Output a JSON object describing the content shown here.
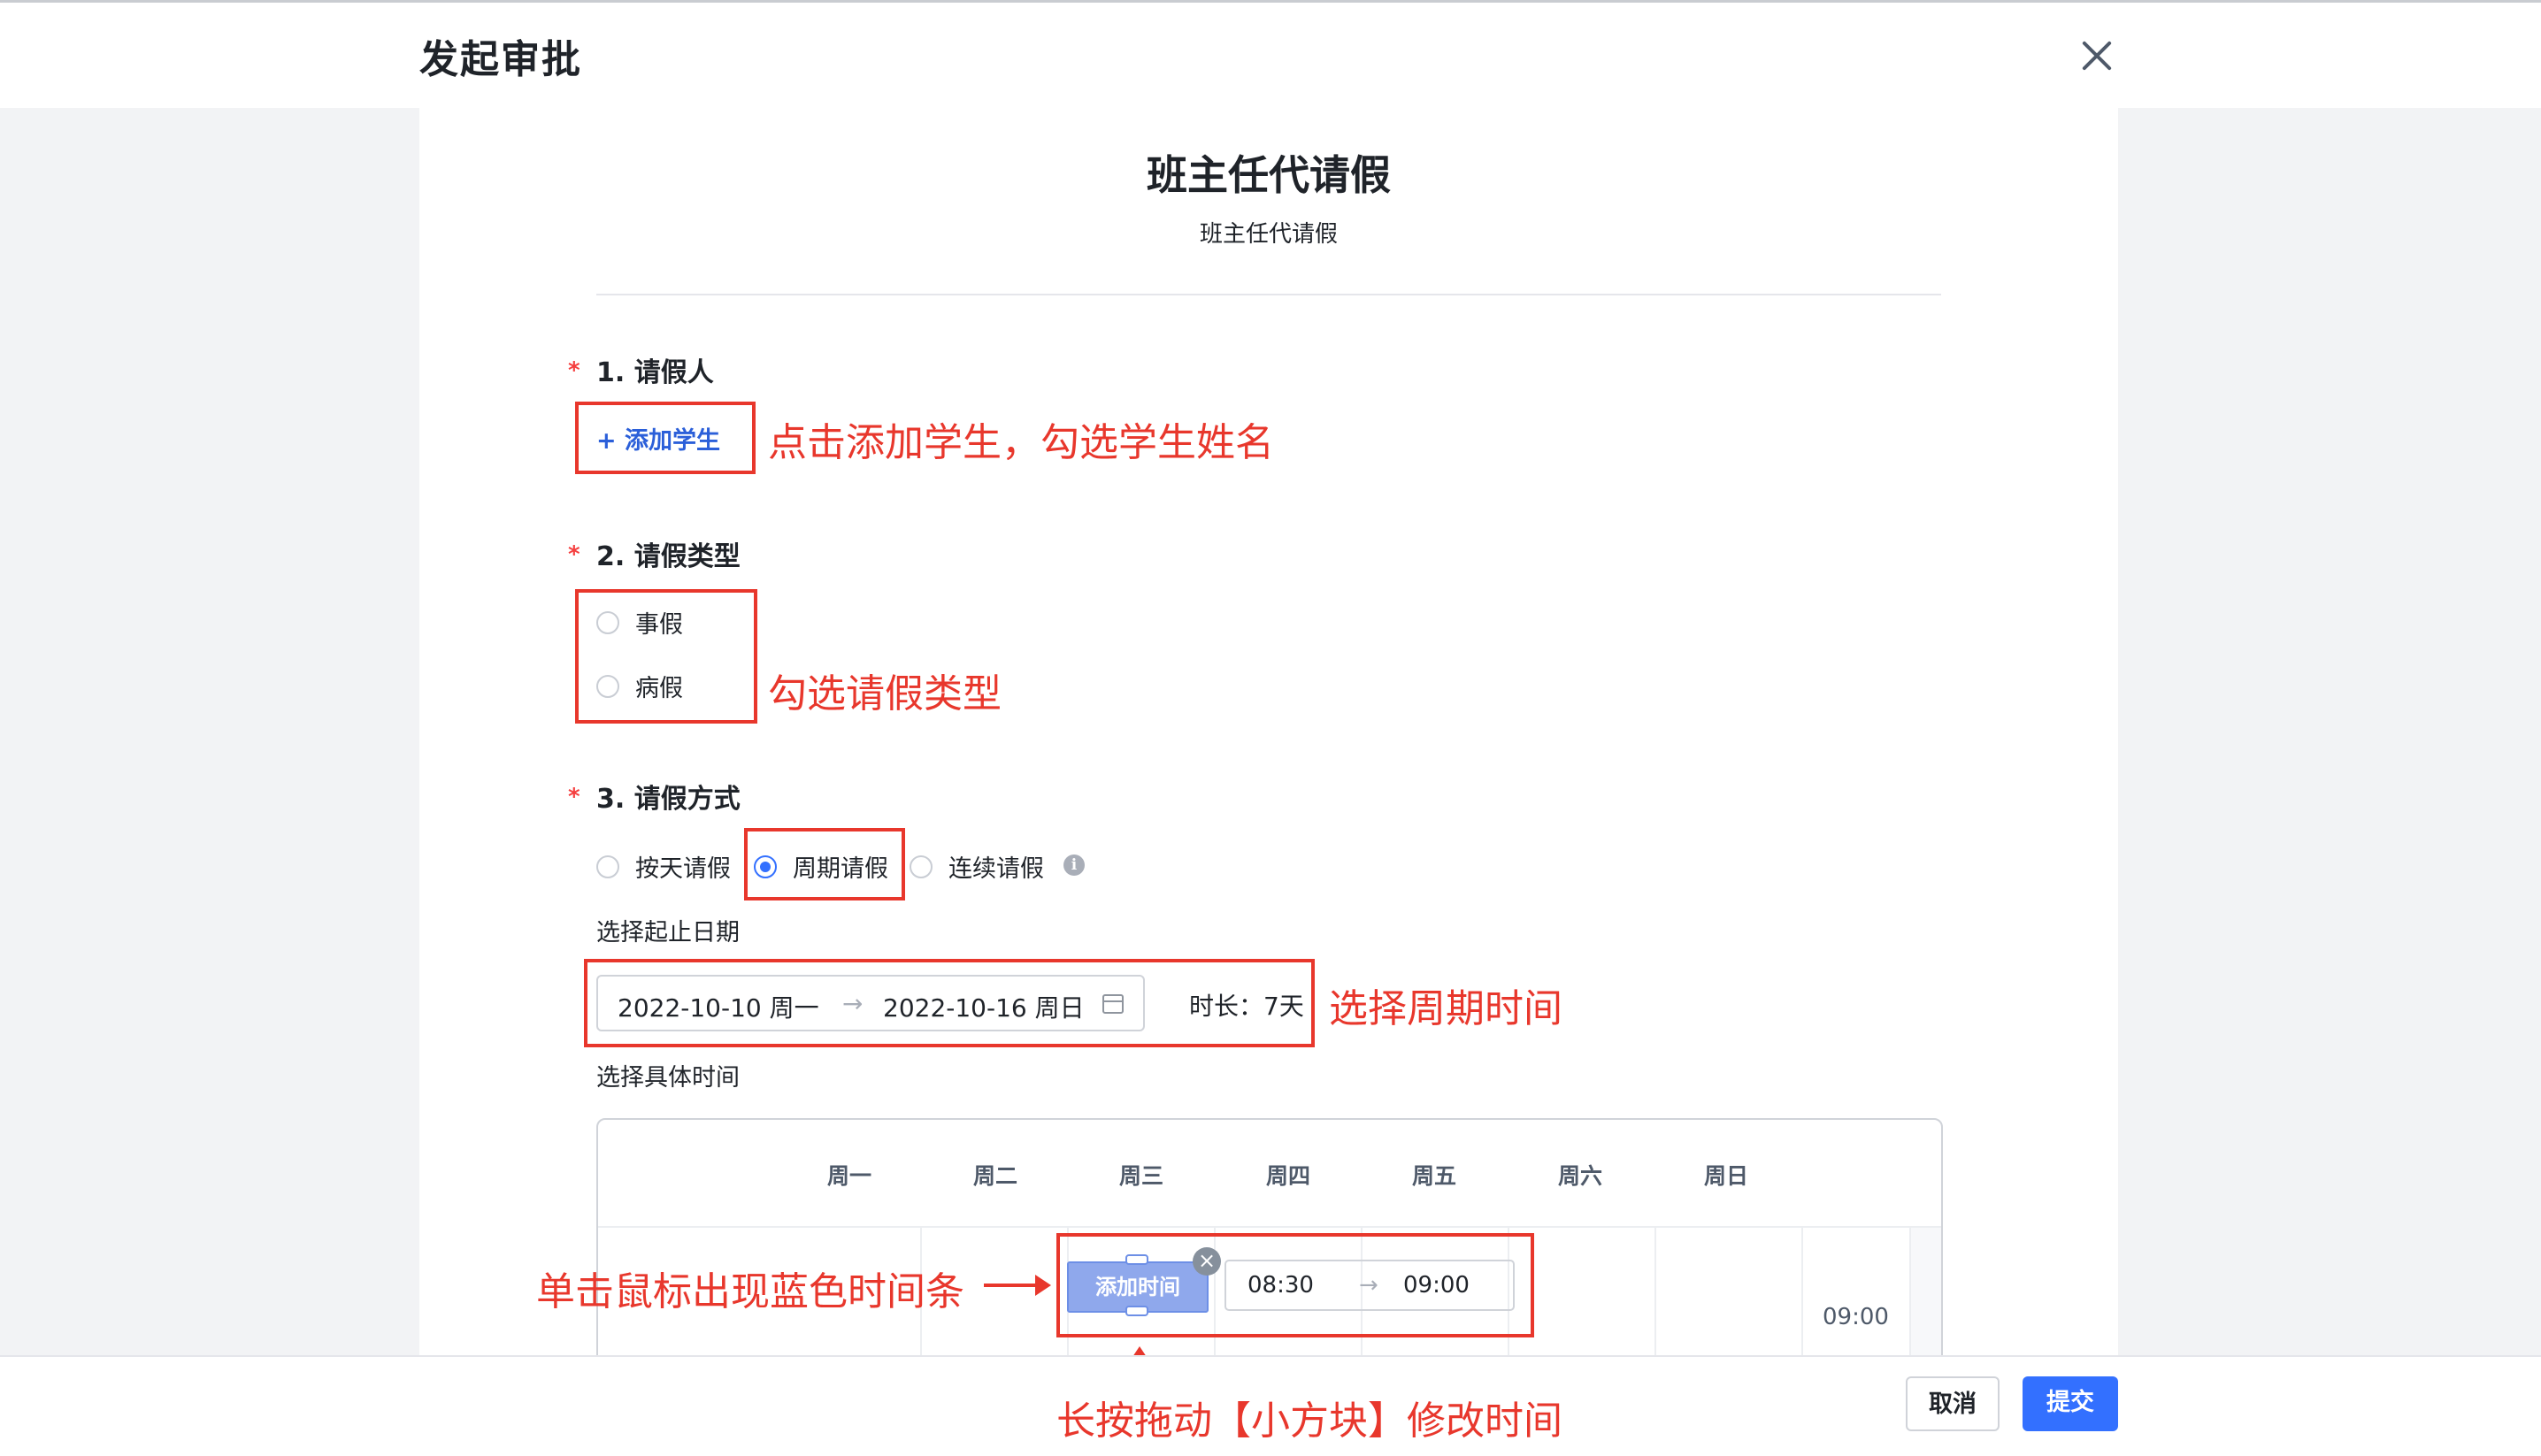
{
  "dialog": {
    "title": "发起审批",
    "close_icon": "close-icon"
  },
  "form": {
    "title": "班主任代请假",
    "subtitle": "班主任代请假"
  },
  "q1": {
    "label": "1. 请假人",
    "add_button": "+ 添加学生",
    "annotation": "点击添加学生，勾选学生姓名"
  },
  "q2": {
    "label": "2. 请假类型",
    "options": [
      "事假",
      "病假"
    ],
    "annotation": "勾选请假类型"
  },
  "q3": {
    "label": "3. 请假方式",
    "modes": [
      "按天请假",
      "周期请假",
      "连续请假"
    ],
    "selected_mode": "周期请假",
    "date_label": "选择起止日期",
    "date_start": "2022-10-10 周一",
    "date_end": "2022-10-16 周日",
    "range_arrow": "→",
    "duration": "时长：7天",
    "date_annotation": "选择周期时间",
    "time_label": "选择具体时间",
    "days": [
      "周一",
      "周二",
      "周三",
      "周四",
      "周五",
      "周六",
      "周日"
    ],
    "row_time": "09:00",
    "bar_label": "添加时间",
    "bar_start": "08:30",
    "bar_end": "09:00",
    "bar_annotation": "单击鼠标出现蓝色时间条",
    "drag_annotation": "长按拖动【小方块】修改时间"
  },
  "footer": {
    "cancel": "取消",
    "submit": "提交"
  },
  "colors": {
    "accent": "#3370ff",
    "annotation": "#e8372c",
    "required": "#f53f3f"
  }
}
